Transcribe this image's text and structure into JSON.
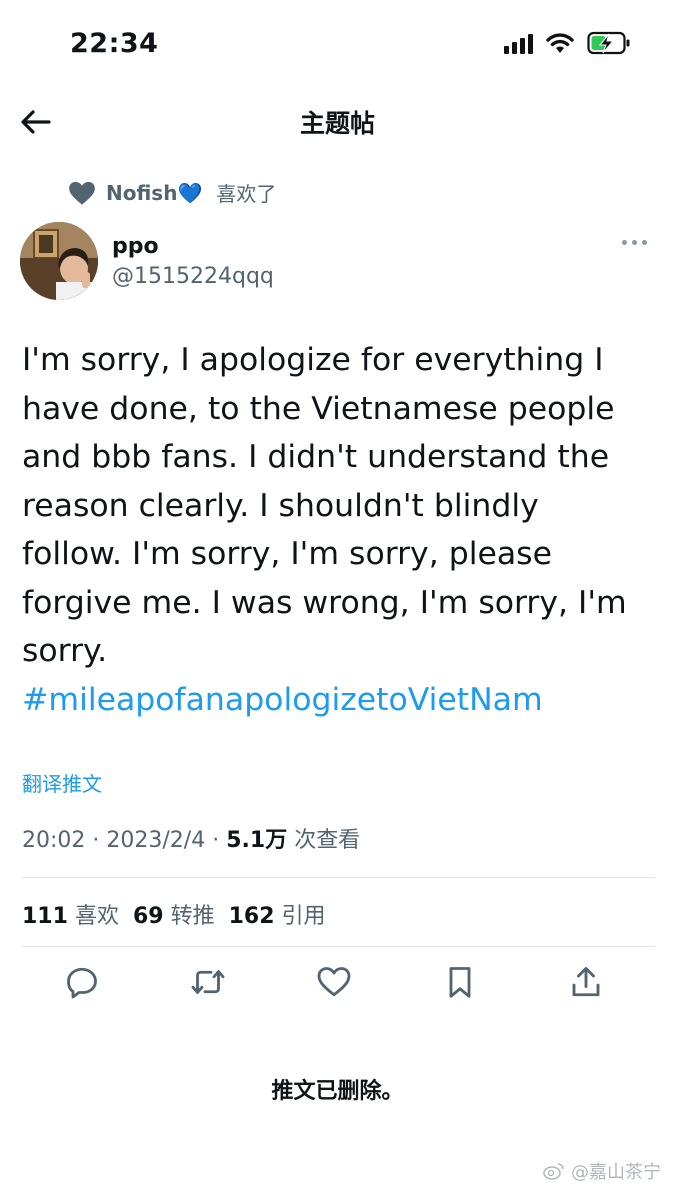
{
  "status_bar": {
    "time": "22:34"
  },
  "nav": {
    "title": "主题帖"
  },
  "social_context": {
    "liker": "Nofish💙",
    "text": "喜欢了"
  },
  "author": {
    "name": "ppo",
    "handle": "@1515224qqq"
  },
  "tweet": {
    "lines": [
      "I'm sorry, I apologize for everything I",
      "have done, to the Vietnamese people",
      "and bbb fans. I didn't understand the",
      "reason clearly. I shouldn't blindly",
      "follow. I'm sorry, I'm sorry, please",
      "forgive me. I was wrong, I'm sorry, I'm",
      "sorry."
    ],
    "hashtag": "#mileapofanapologizetoVietNam",
    "translate_label": "翻译推文"
  },
  "meta": {
    "time": "20:02",
    "date": "2023/2/4",
    "views_count": "5.1万",
    "views_label": "次查看"
  },
  "stats": {
    "likes_count": "111",
    "likes_label": "喜欢",
    "retweets_count": "69",
    "retweets_label": "转推",
    "quotes_count": "162",
    "quotes_label": "引用"
  },
  "actions": [
    "reply-icon",
    "retweet-icon",
    "like-icon",
    "bookmark-icon",
    "share-icon"
  ],
  "deleted_note": "推文已删除。",
  "watermark": "@嘉山茶宁",
  "colors": {
    "accent": "#1d9bf0",
    "secondary_text": "#536471",
    "primary_text": "#0f1419",
    "heart": "#536471"
  }
}
